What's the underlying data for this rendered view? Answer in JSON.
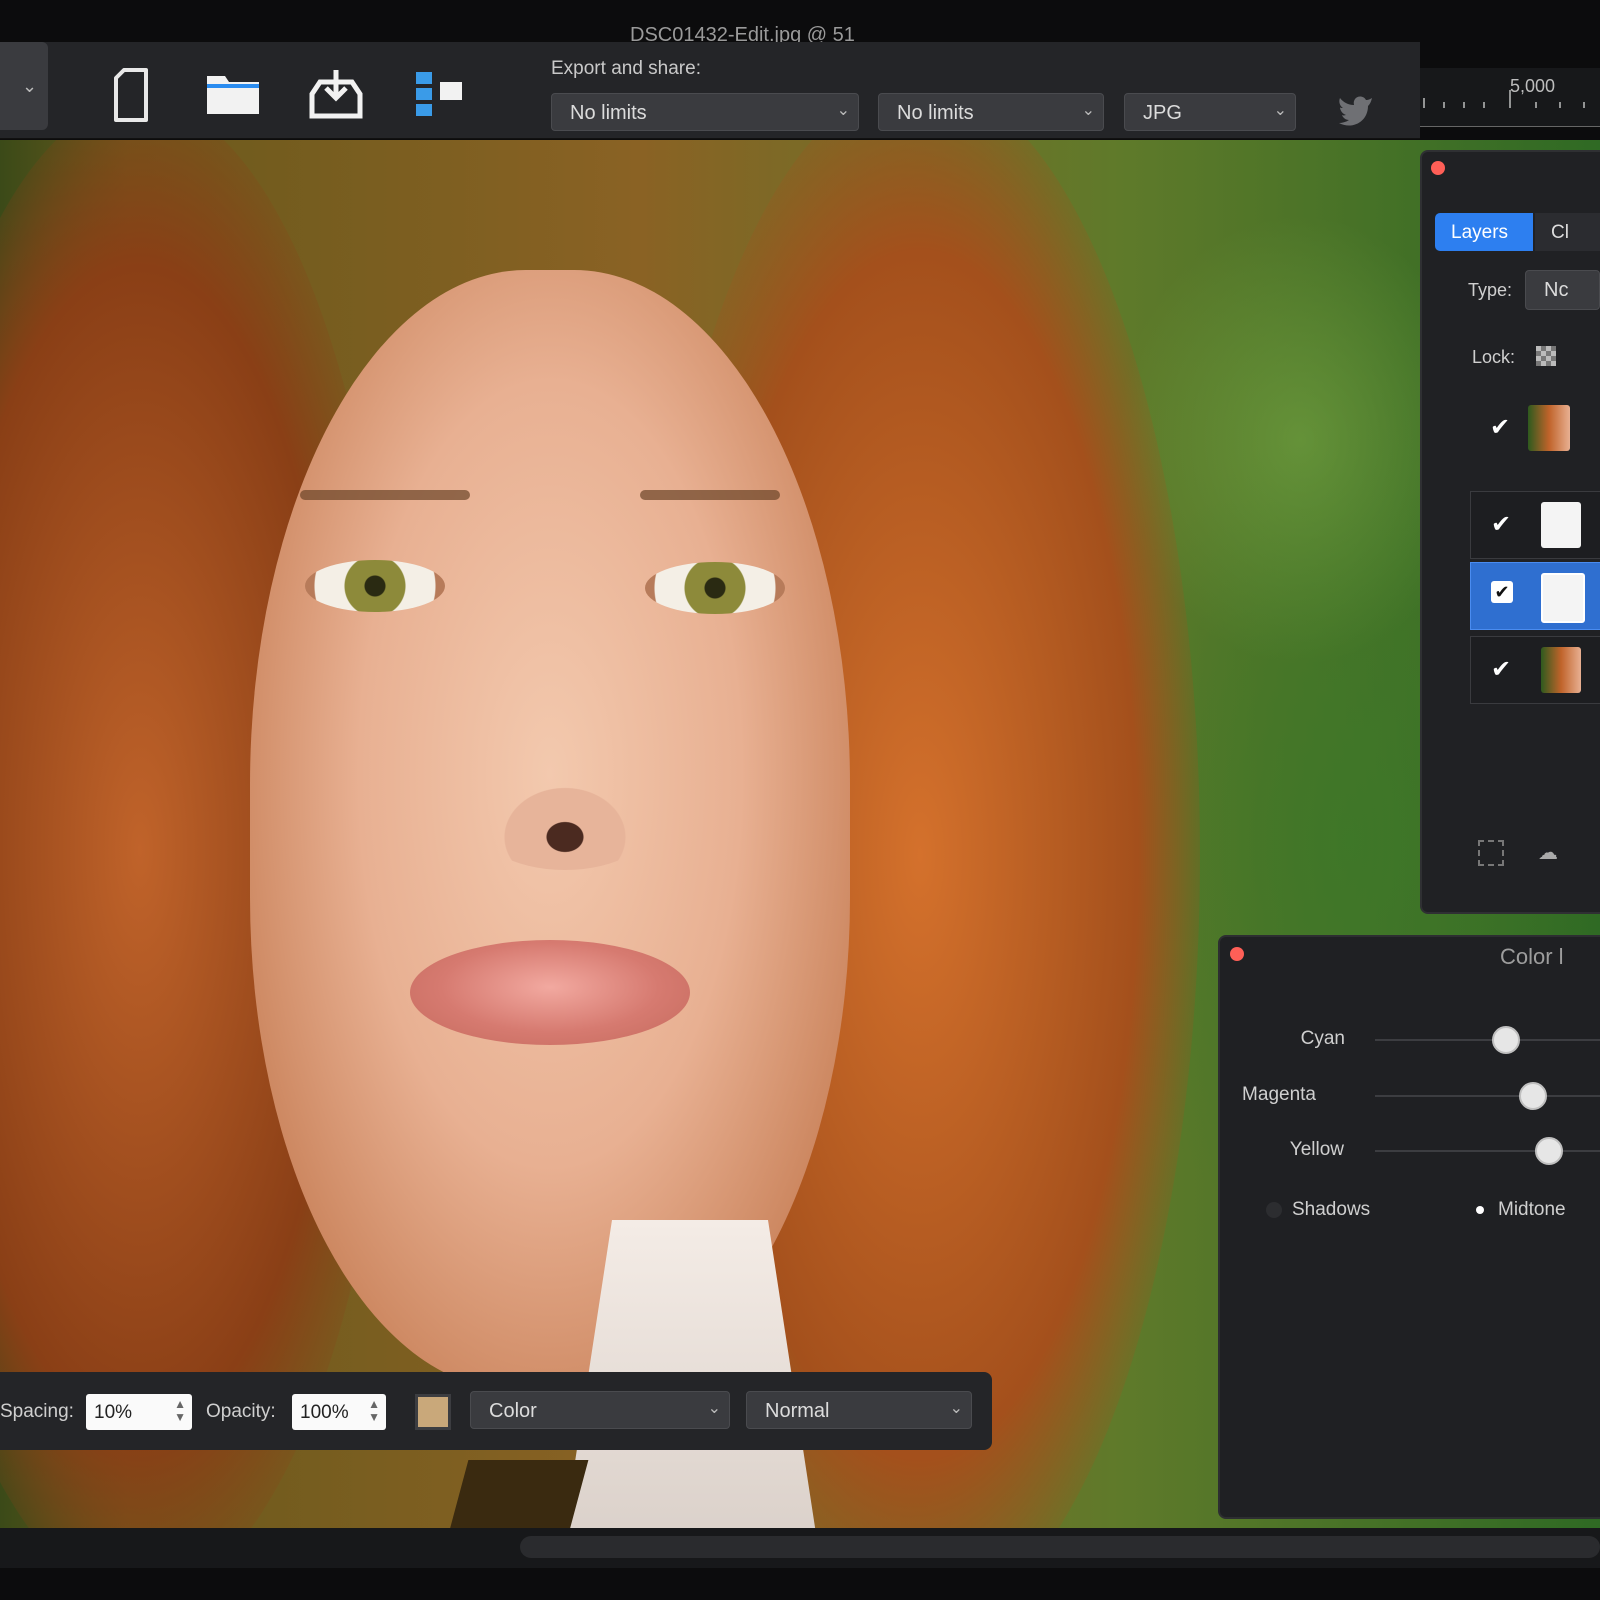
{
  "window": {
    "title": "DSC01432-Edit.jpg @ 51"
  },
  "toolbar": {
    "icons": [
      "new-document-icon",
      "open-folder-icon",
      "save-tray-icon",
      "arrange-icon"
    ],
    "export_label": "Export and share:",
    "export_size": "No limits",
    "export_filesize": "No limits",
    "export_format": "JPG",
    "share_icon": "twitter-icon"
  },
  "ruler": {
    "label": "5,000"
  },
  "layers_panel": {
    "tabs": [
      "Layers",
      "Cl"
    ],
    "type_label": "Type:",
    "type_value": "Nc",
    "lock_label": "Lock:",
    "rows": [
      {
        "checked": true,
        "selected": false
      },
      {
        "checked": true,
        "selected": false
      },
      {
        "checked": true,
        "selected": true
      },
      {
        "checked": true,
        "selected": false
      }
    ]
  },
  "color_panel": {
    "title": "Color l",
    "sliders": [
      {
        "label": "Cyan",
        "value": 0.58
      },
      {
        "label": "Magenta",
        "value": 0.7
      },
      {
        "label": "Yellow",
        "value": 0.77
      }
    ],
    "tone_options": [
      {
        "label": "Shadows",
        "selected": false
      },
      {
        "label": "Midtone",
        "selected": true
      }
    ]
  },
  "brushbar": {
    "spacing_label": "Spacing:",
    "spacing_value": "10%",
    "opacity_label": "Opacity:",
    "opacity_value": "100%",
    "swatch_color": "#c9a87a",
    "mode_value": "Color",
    "blend_value": "Normal"
  },
  "colors": {
    "accent": "#2d7ff0",
    "close": "#ff5f57",
    "panel": "#242528"
  }
}
